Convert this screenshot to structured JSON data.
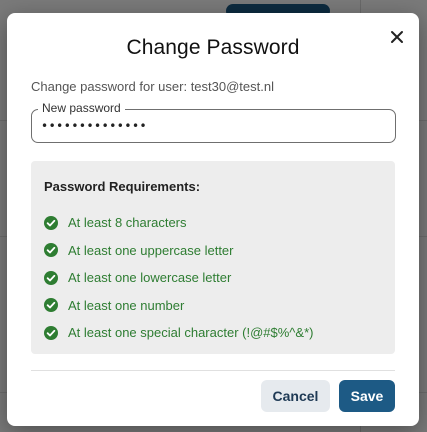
{
  "dialog": {
    "title": "Change Password",
    "subtitle": "Change password for user: test30@test.nl",
    "password_label": "New password",
    "password_value": "••••••••••••••",
    "requirements_title": "Password Requirements:",
    "requirements": [
      {
        "label": "At least 8 characters",
        "met": true
      },
      {
        "label": "At least one uppercase letter",
        "met": true
      },
      {
        "label": "At least one lowercase letter",
        "met": true
      },
      {
        "label": "At least one number",
        "met": true
      },
      {
        "label": "At least one special character (!@#$%^&*)",
        "met": true
      }
    ],
    "cancel_label": "Cancel",
    "save_label": "Save"
  },
  "colors": {
    "primary": "#1d5a85",
    "success": "#2e7d32",
    "requirements_bg": "#ededed"
  },
  "icons": {
    "close": "close-icon",
    "requirement": "check-circle-icon"
  }
}
